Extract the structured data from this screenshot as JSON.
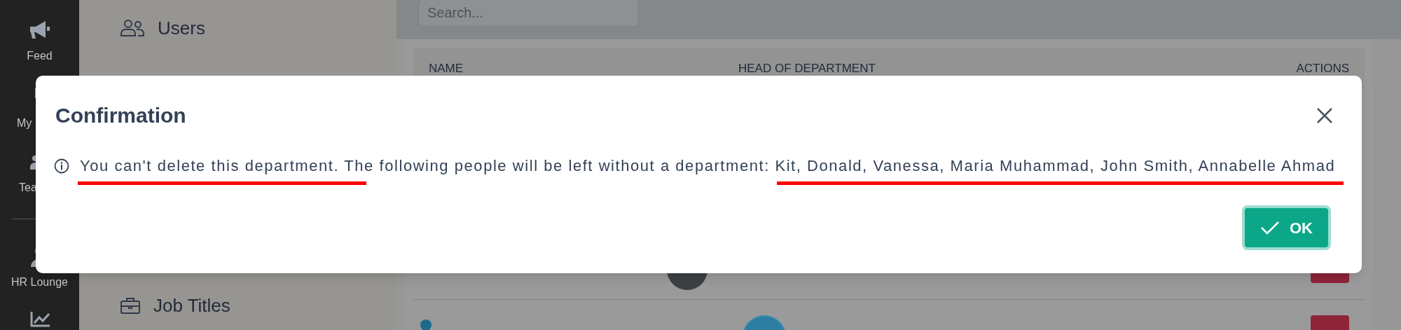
{
  "nav": {
    "items": [
      {
        "label": "Feed",
        "kind": "megaphone",
        "divider_after": false
      },
      {
        "label": "My",
        "kind": "thumb",
        "divider_after": false
      },
      {
        "label": "Tea",
        "kind": "team",
        "divider_after": true
      },
      {
        "label": "HR Lounge",
        "kind": "person",
        "divider_after": false
      },
      {
        "kind": "chart",
        "divider_after": false
      }
    ]
  },
  "settings_menu": {
    "items": [
      {
        "label": "Users",
        "kind": "users"
      },
      {
        "label": "Job Titles",
        "kind": "briefcase"
      }
    ]
  },
  "search": {
    "placeholder": "Search..."
  },
  "table": {
    "columns": [
      "NAME",
      "HEAD OF DEPARTMENT",
      "ACTIONS"
    ]
  },
  "dialog": {
    "title": "Confirmation",
    "message": "You can't delete this department. The following people will be left without a department: Kit, Donald, Vanessa, Maria Muhammad, John Smith, Annabelle Ahmad",
    "ok": "OK"
  }
}
